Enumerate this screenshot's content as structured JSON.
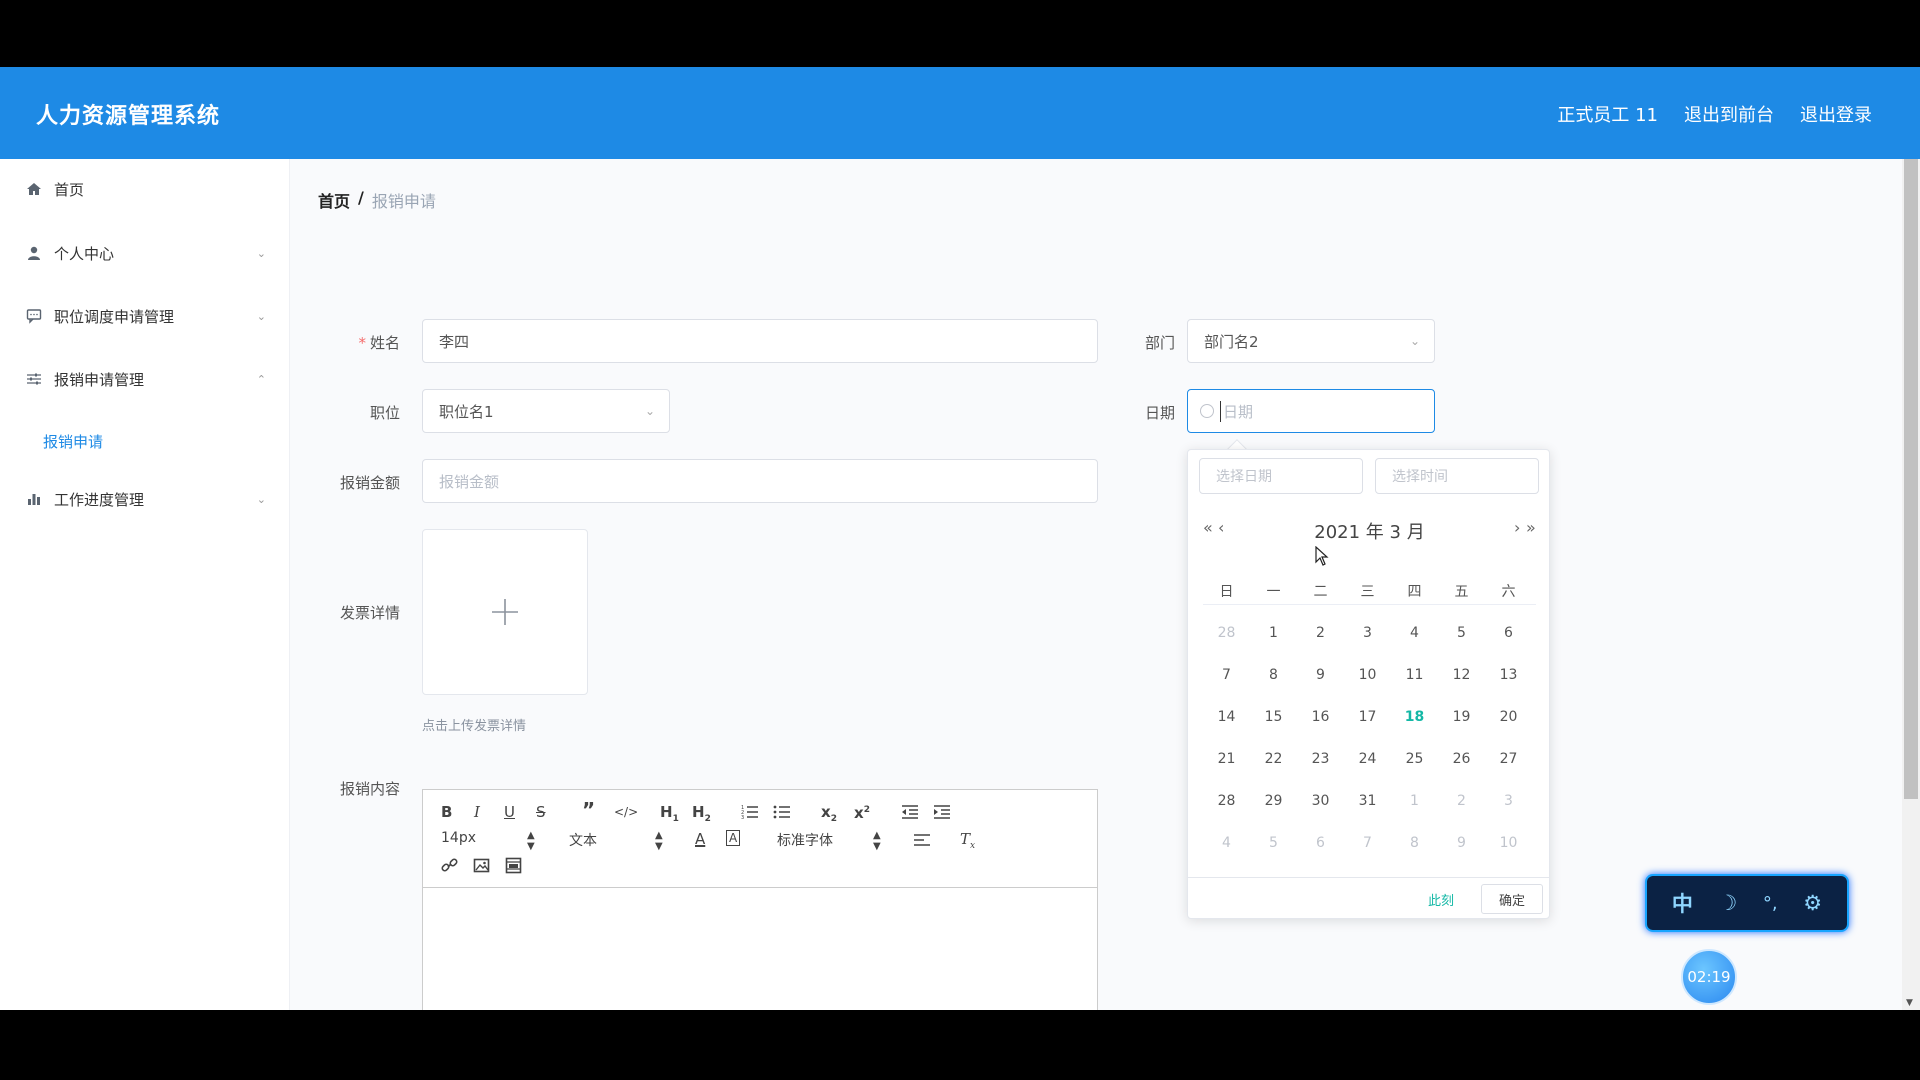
{
  "header": {
    "title": "人力资源管理系统",
    "links": [
      "正式员工 11",
      "退出到前台",
      "退出登录"
    ]
  },
  "sidebar": {
    "items": [
      {
        "label": "首页",
        "icon": "home-icon"
      },
      {
        "label": "个人中心",
        "icon": "user-icon"
      },
      {
        "label": "职位调度申请管理",
        "icon": "chat-icon"
      },
      {
        "label": "报销申请管理",
        "icon": "sliders-icon"
      },
      {
        "label": "工作进度管理",
        "icon": "bar-chart-icon"
      }
    ],
    "submenu_active": "报销申请"
  },
  "breadcrumb": {
    "home": "首页",
    "sep": "/",
    "current": "报销申请"
  },
  "form": {
    "name_label": "姓名",
    "name_value": "李四",
    "dept_label": "部门",
    "dept_value": "部门名2",
    "position_label": "职位",
    "position_value": "职位名1",
    "date_label": "日期",
    "date_placeholder": "日期",
    "amount_label": "报销金额",
    "amount_placeholder": "报销金额",
    "invoice_label": "发票详情",
    "invoice_tip": "点击上传发票详情",
    "content_label": "报销内容"
  },
  "editor": {
    "font_size": "14px",
    "header_select": "文本",
    "font_select": "标准字体"
  },
  "datepicker": {
    "date_placeholder": "选择日期",
    "time_placeholder": "选择时间",
    "year_label": "2021 年",
    "month_label": "3 月",
    "weekdays": [
      "日",
      "一",
      "二",
      "三",
      "四",
      "五",
      "六"
    ],
    "weeks": [
      [
        "28",
        "1",
        "2",
        "3",
        "4",
        "5",
        "6"
      ],
      [
        "7",
        "8",
        "9",
        "10",
        "11",
        "12",
        "13"
      ],
      [
        "14",
        "15",
        "16",
        "17",
        "18",
        "19",
        "20"
      ],
      [
        "21",
        "22",
        "23",
        "24",
        "25",
        "26",
        "27"
      ],
      [
        "28",
        "29",
        "30",
        "31",
        "1",
        "2",
        "3"
      ],
      [
        "4",
        "5",
        "6",
        "7",
        "8",
        "9",
        "10"
      ]
    ],
    "today": "18",
    "now_label": "此刻",
    "ok_label": "确定"
  },
  "ime": {
    "mode": "中"
  },
  "timer": "02:19",
  "colors": {
    "primary": "#1e8ae5",
    "today": "#14b8a6",
    "required": "#f56c6c"
  }
}
